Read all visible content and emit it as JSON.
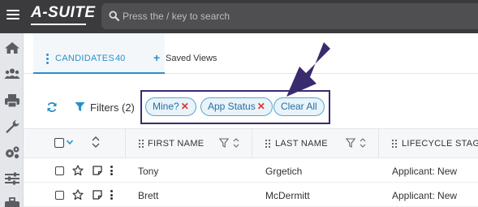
{
  "app": {
    "logo": "A-SUITE"
  },
  "search": {
    "placeholder": "Press the / key to search"
  },
  "tabs": {
    "candidates_label": "CANDIDATES",
    "candidates_count": "40",
    "saved_views_label": "Saved Views"
  },
  "filters": {
    "label": "Filters (2)",
    "chips": [
      {
        "label": "Mine?",
        "removable": true
      },
      {
        "label": "App Status",
        "removable": true
      },
      {
        "label": "Clear All",
        "removable": false
      }
    ],
    "remove_glyph": "✕"
  },
  "grid": {
    "columns": [
      "FIRST NAME",
      "LAST NAME",
      "LIFECYCLE STAGE"
    ],
    "rows": [
      {
        "first_name": "Tony",
        "last_name": "Grgetich",
        "lifecycle_stage": "Applicant: New"
      },
      {
        "first_name": "Brett",
        "last_name": "McDermitt",
        "lifecycle_stage": "Applicant: New"
      }
    ]
  },
  "colors": {
    "topbar": "#3b3b3d",
    "accent": "#2a8fc9",
    "annotation": "#3a2a6e",
    "chip_remove": "#e2322b"
  },
  "icons": {
    "left_nav": [
      "home-icon",
      "users-icon",
      "printer-icon",
      "wrench-icon",
      "gears-icon",
      "sliders-icon",
      "briefcase-icon"
    ]
  }
}
